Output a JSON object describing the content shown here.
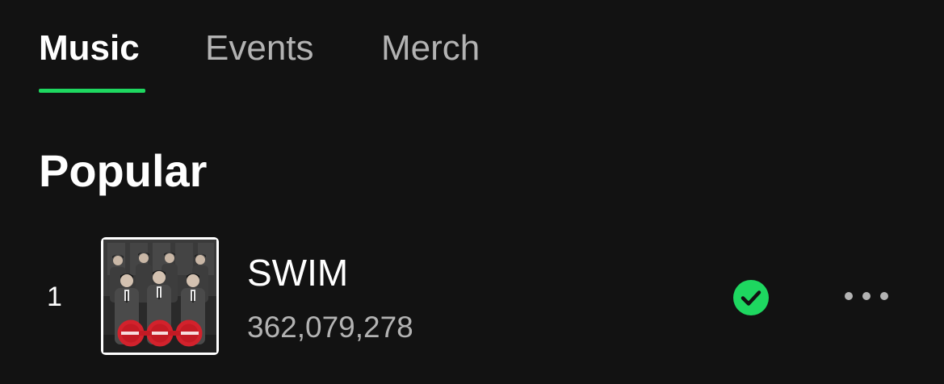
{
  "tabs": [
    {
      "label": "Music",
      "active": true
    },
    {
      "label": "Events",
      "active": false
    },
    {
      "label": "Merch",
      "active": false
    }
  ],
  "section": {
    "title": "Popular"
  },
  "tracks": [
    {
      "index": "1",
      "title": "SWIM",
      "plays": "362,079,278",
      "saved": true,
      "cover_icon": "album-cover-image"
    }
  ],
  "colors": {
    "background": "#121212",
    "accent": "#1ed760",
    "primary_text": "#ffffff",
    "secondary_text": "#b3b3b3"
  },
  "icons": {
    "saved": "check-circle-icon",
    "more": "more-options-icon"
  }
}
